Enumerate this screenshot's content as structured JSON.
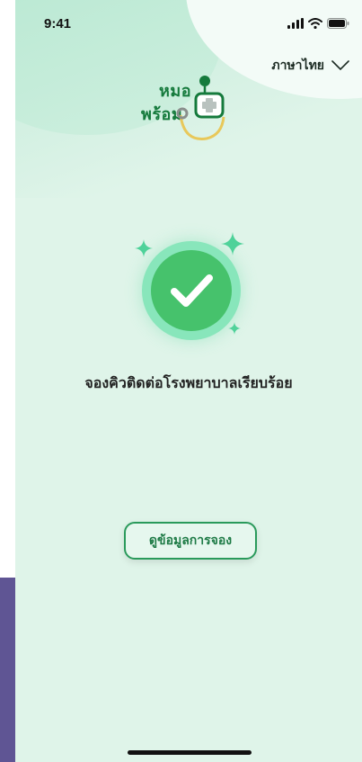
{
  "status_bar": {
    "time": "9:41",
    "icons": [
      "cellular-signal-icon",
      "wifi-icon",
      "battery-icon"
    ]
  },
  "header": {
    "language_label": "ภาษาไทย",
    "language_icon": "chevron-down-icon"
  },
  "logo": {
    "line1": "หมอ",
    "line2": "พร้อม",
    "icon": "stethoscope-icon"
  },
  "main": {
    "success_icon": "check-circle-icon",
    "success_message": "จองคิวติดต่อโรงพยาบาลเรียบร้อย",
    "view_booking_label": "ดูข้อมูลการจอง"
  },
  "colors": {
    "background": "#dff4e9",
    "brand_green": "#157a3c",
    "success_green": "#46c26c",
    "button_border": "#2a9a5b"
  }
}
